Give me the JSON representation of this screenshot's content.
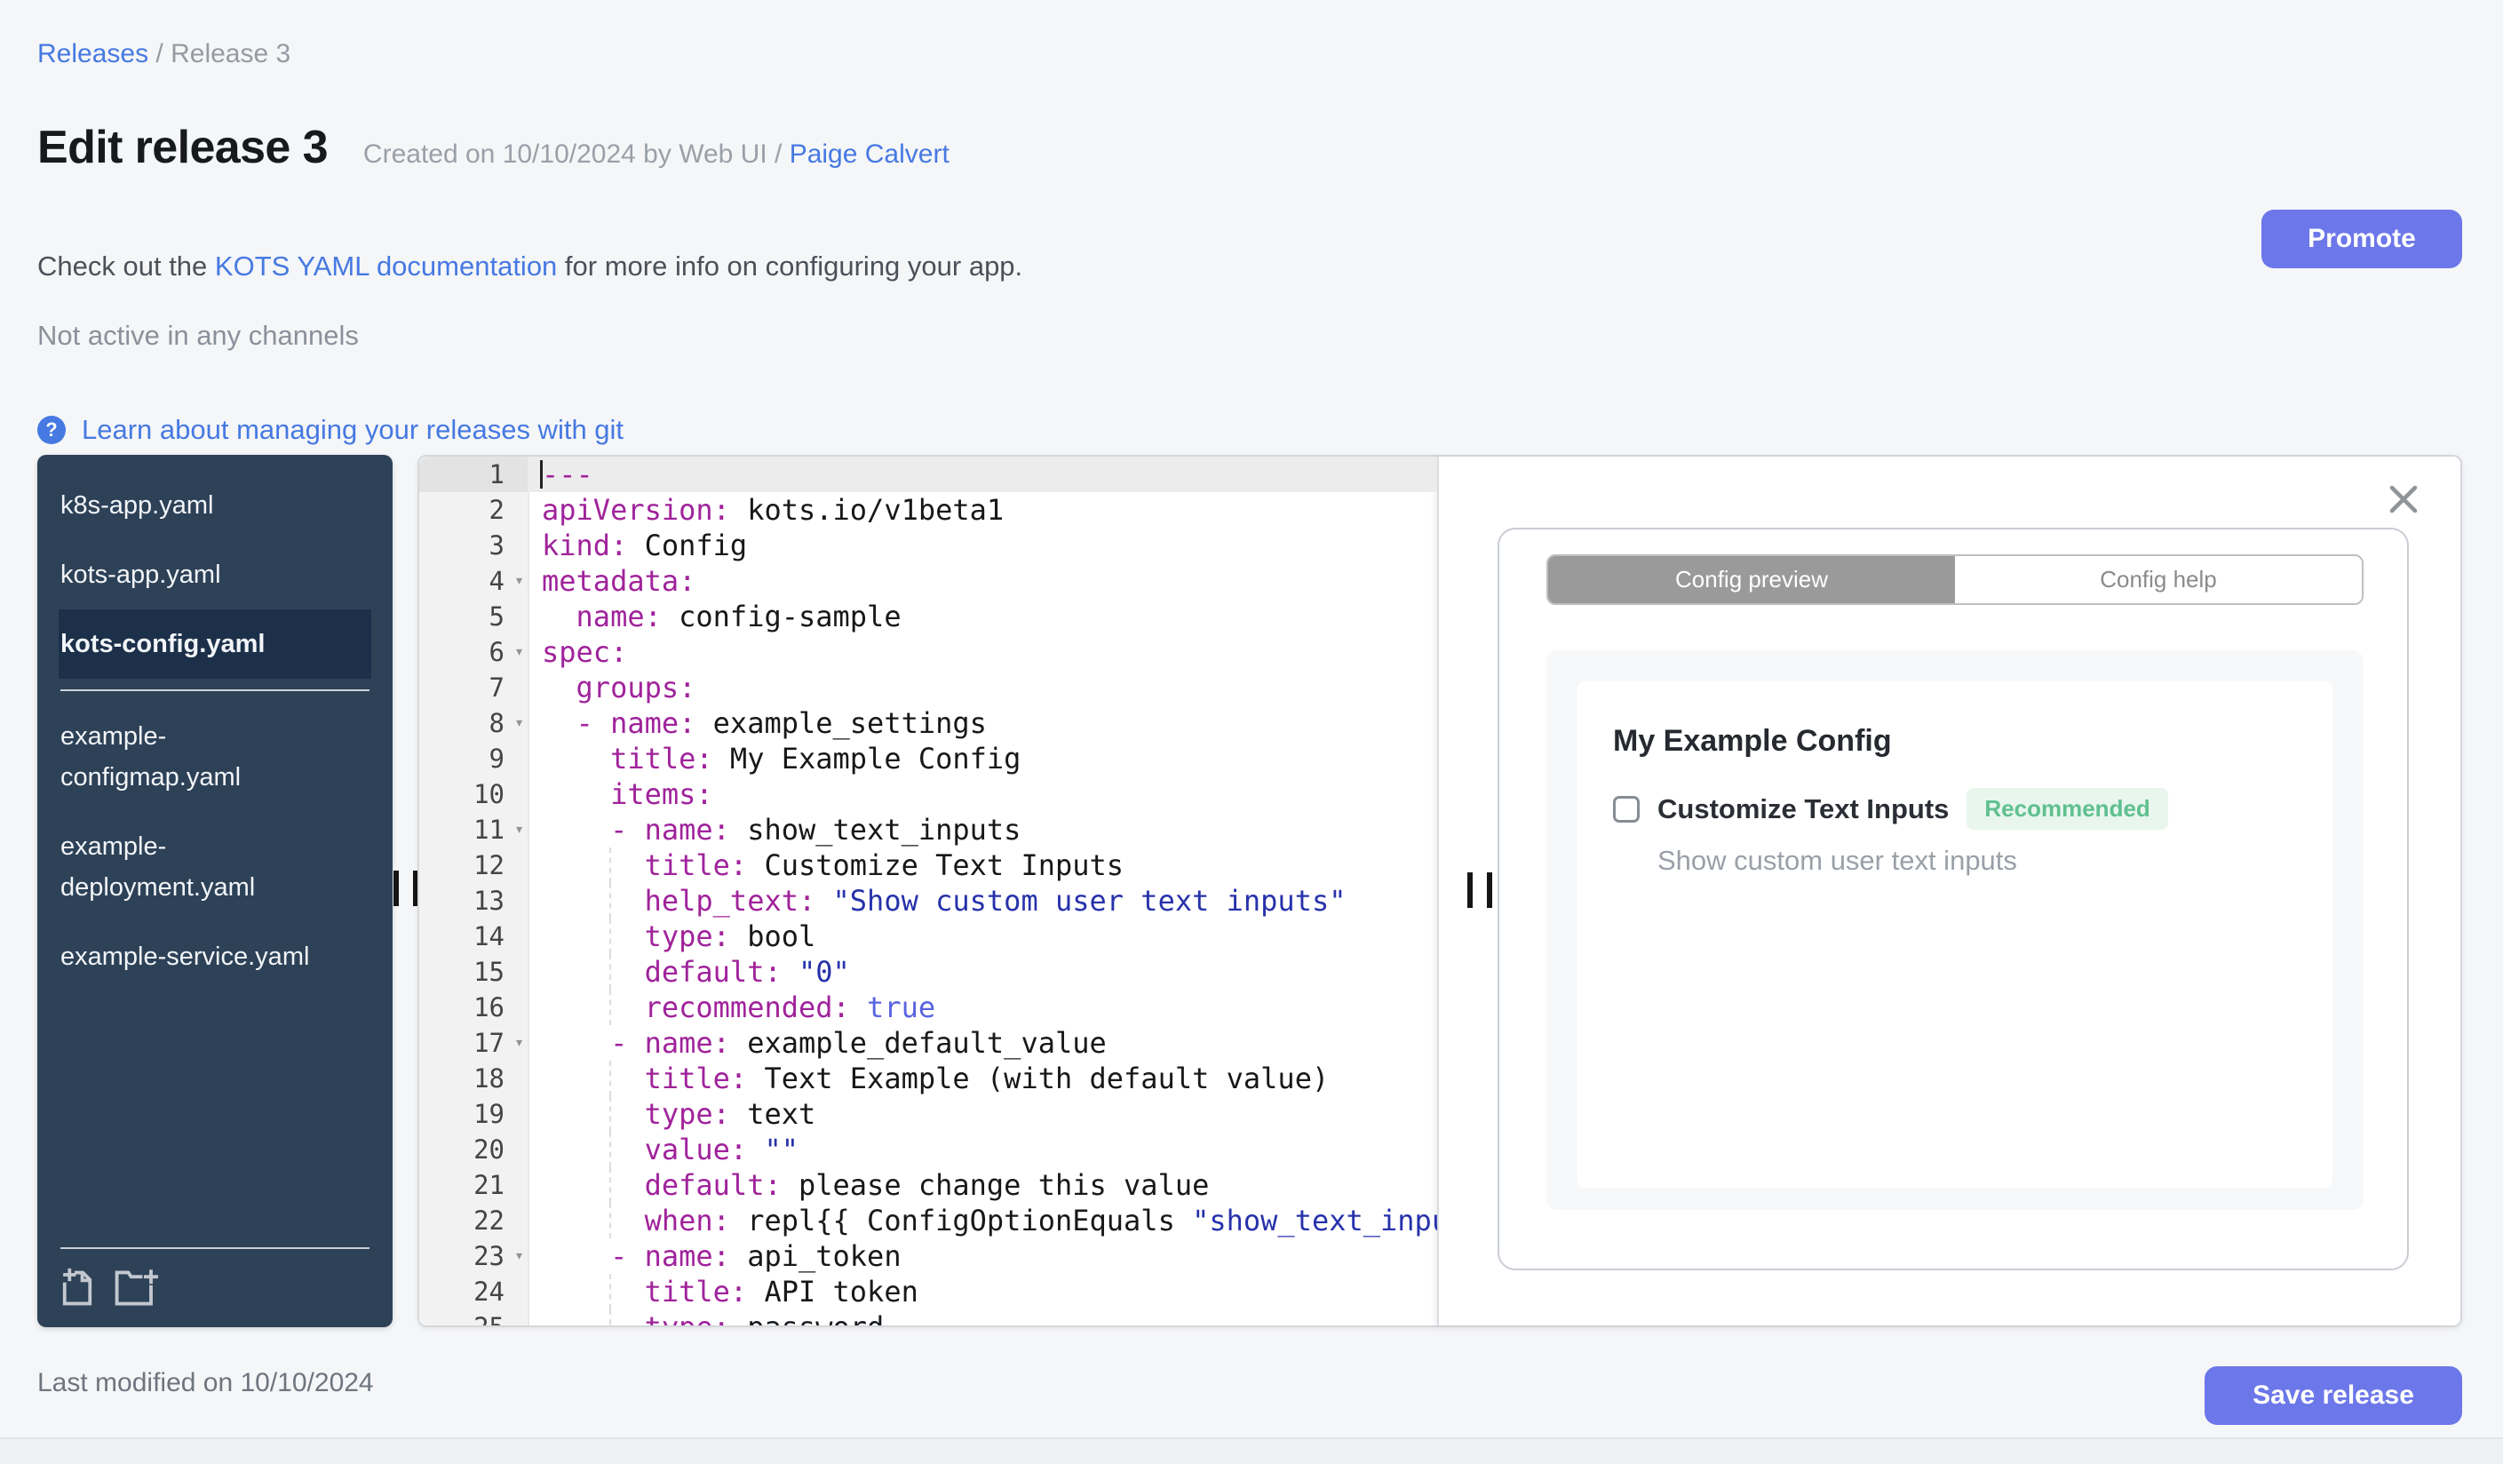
{
  "breadcrumb": {
    "link": "Releases",
    "separator": " / ",
    "current": "Release 3"
  },
  "header": {
    "title": "Edit release 3",
    "created_prefix": "Created on 10/10/2024 by Web UI / ",
    "created_author": "Paige Calvert",
    "doc_prefix": "Check out the ",
    "doc_link": "KOTS YAML documentation",
    "doc_suffix": " for more info on configuring your app.",
    "channel_status": "Not active in any channels",
    "promote_label": "Promote",
    "git_help_label": "Learn about managing your releases with git",
    "help_icon": "question-mark-icon"
  },
  "sidebar": {
    "files": [
      {
        "name": "k8s-app.yaml"
      },
      {
        "name": "kots-app.yaml"
      },
      {
        "name": "kots-config.yaml",
        "selected": true
      },
      {
        "divider": true
      },
      {
        "name": "example-configmap.yaml"
      },
      {
        "name": "example-deployment.yaml"
      },
      {
        "name": "example-service.yaml"
      }
    ],
    "actions": [
      {
        "icon": "new-file-icon"
      },
      {
        "icon": "new-folder-icon"
      }
    ]
  },
  "editor": {
    "lines": [
      {
        "n": 1,
        "active": true,
        "cursor": true,
        "tokens": [
          [
            "key",
            "---"
          ]
        ]
      },
      {
        "n": 2,
        "tokens": [
          [
            "key",
            "apiVersion:"
          ],
          [
            "plain",
            " kots.io/v1beta1"
          ]
        ]
      },
      {
        "n": 3,
        "tokens": [
          [
            "key",
            "kind:"
          ],
          [
            "plain",
            " Config"
          ]
        ]
      },
      {
        "n": 4,
        "fold": true,
        "tokens": [
          [
            "key",
            "metadata:"
          ]
        ]
      },
      {
        "n": 5,
        "tokens": [
          [
            "plain",
            "  "
          ],
          [
            "key",
            "name:"
          ],
          [
            "plain",
            " config-sample"
          ]
        ]
      },
      {
        "n": 6,
        "fold": true,
        "tokens": [
          [
            "key",
            "spec:"
          ]
        ]
      },
      {
        "n": 7,
        "tokens": [
          [
            "plain",
            "  "
          ],
          [
            "key",
            "groups:"
          ]
        ]
      },
      {
        "n": 8,
        "fold": true,
        "tokens": [
          [
            "key",
            "  - name:"
          ],
          [
            "plain",
            " example_settings"
          ]
        ]
      },
      {
        "n": 9,
        "tokens": [
          [
            "key",
            "    title:"
          ],
          [
            "plain",
            " My Example Config"
          ]
        ]
      },
      {
        "n": 10,
        "tokens": [
          [
            "key",
            "    items:"
          ]
        ]
      },
      {
        "n": 11,
        "fold": true,
        "tokens": [
          [
            "key",
            "    - name:"
          ],
          [
            "plain",
            " show_text_inputs"
          ]
        ]
      },
      {
        "n": 12,
        "guide": true,
        "tokens": [
          [
            "key",
            "      title:"
          ],
          [
            "plain",
            " Customize Text Inputs"
          ]
        ]
      },
      {
        "n": 13,
        "guide": true,
        "tokens": [
          [
            "key",
            "      help_text:"
          ],
          [
            "plain",
            " "
          ],
          [
            "str",
            "\"Show custom user text inputs\""
          ]
        ]
      },
      {
        "n": 14,
        "guide": true,
        "tokens": [
          [
            "key",
            "      type:"
          ],
          [
            "plain",
            " bool"
          ]
        ]
      },
      {
        "n": 15,
        "guide": true,
        "tokens": [
          [
            "key",
            "      default:"
          ],
          [
            "plain",
            " "
          ],
          [
            "str",
            "\"0\""
          ]
        ]
      },
      {
        "n": 16,
        "guide": true,
        "tokens": [
          [
            "key",
            "      recommended:"
          ],
          [
            "plain",
            " "
          ],
          [
            "atom",
            "true"
          ]
        ]
      },
      {
        "n": 17,
        "fold": true,
        "tokens": [
          [
            "key",
            "    - name:"
          ],
          [
            "plain",
            " example_default_value"
          ]
        ]
      },
      {
        "n": 18,
        "guide": true,
        "tokens": [
          [
            "key",
            "      title:"
          ],
          [
            "plain",
            " Text Example (with default value)"
          ]
        ]
      },
      {
        "n": 19,
        "guide": true,
        "tokens": [
          [
            "key",
            "      type:"
          ],
          [
            "plain",
            " text"
          ]
        ]
      },
      {
        "n": 20,
        "guide": true,
        "tokens": [
          [
            "key",
            "      value:"
          ],
          [
            "plain",
            " "
          ],
          [
            "str",
            "\"\""
          ]
        ]
      },
      {
        "n": 21,
        "guide": true,
        "tokens": [
          [
            "key",
            "      default:"
          ],
          [
            "plain",
            " please change this value"
          ]
        ]
      },
      {
        "n": 22,
        "guide": true,
        "tokens": [
          [
            "key",
            "      when:"
          ],
          [
            "plain",
            " repl{{ ConfigOptionEquals "
          ],
          [
            "str",
            "\"show_text_inputs\""
          ]
        ]
      },
      {
        "n": 23,
        "fold": true,
        "tokens": [
          [
            "key",
            "    - name:"
          ],
          [
            "plain",
            " api_token"
          ]
        ]
      },
      {
        "n": 24,
        "guide": true,
        "tokens": [
          [
            "key",
            "      title:"
          ],
          [
            "plain",
            " API token"
          ]
        ]
      },
      {
        "n": 25,
        "guide": true,
        "tokens": [
          [
            "key",
            "      type:"
          ],
          [
            "plain",
            " password"
          ]
        ]
      }
    ]
  },
  "preview": {
    "close_icon": "close-icon",
    "tabs": [
      {
        "label": "Config preview",
        "active": true
      },
      {
        "label": "Config help",
        "active": false
      }
    ],
    "group_title": "My Example Config",
    "item": {
      "label": "Customize Text Inputs",
      "badge": "Recommended",
      "help_text": "Show custom user text inputs",
      "checked": false
    }
  },
  "footer": {
    "last_modified": "Last modified on 10/10/2024",
    "save_label": "Save release"
  },
  "colors": {
    "link_blue": "#4679e2",
    "button_indigo": "#6c77e9",
    "sidebar_navy": "#2d4157",
    "sidebar_selected": "#1c3049",
    "badge_green_text": "#5fc08f",
    "badge_green_bg": "#e8f6ee",
    "code_key": "#a0239b",
    "code_string": "#2732ab",
    "code_atom": "#5a64e0",
    "tab_active_gray": "#9a9a9a"
  }
}
